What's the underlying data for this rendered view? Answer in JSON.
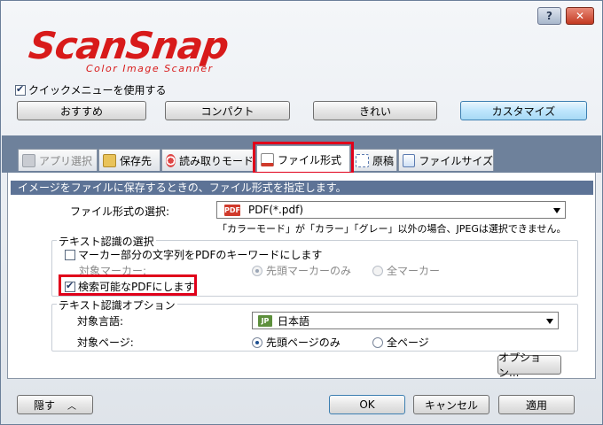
{
  "title_bar": {
    "help_label": "?",
    "close_label": "✕"
  },
  "logo": {
    "brand": "ScanSnap",
    "tagline": "Color Image Scanner"
  },
  "quick_menu": {
    "label": "クイックメニューを使用する",
    "checked": true
  },
  "modes": [
    {
      "label": "おすすめ"
    },
    {
      "label": "コンパクト"
    },
    {
      "label": "きれい"
    },
    {
      "label": "カスタマイズ",
      "selected": true
    }
  ],
  "tabs": [
    {
      "label": "アプリ選択",
      "icon": "app-select-icon",
      "disabled": true
    },
    {
      "label": "保存先",
      "icon": "folder-icon"
    },
    {
      "label": "読み取りモード",
      "icon": "scan-mode-icon"
    },
    {
      "label": "ファイル形式",
      "icon": "file-format-icon",
      "active": true
    },
    {
      "label": "原稿",
      "icon": "paper-icon"
    },
    {
      "label": "ファイルサイズ",
      "icon": "file-size-icon"
    }
  ],
  "panel": {
    "description": "イメージをファイルに保存するときの、ファイル形式を指定します。",
    "format_label": "ファイル形式の選択:",
    "format_value": "PDF(*.pdf)",
    "format_icon_text": "PDF",
    "format_note": "「カラーモード」が「カラー」「グレー」以外の場合、JPEGは選択できません。",
    "text_recognition": {
      "title": "テキスト認識の選択",
      "marker_keyword_label": "マーカー部分の文字列をPDFのキーワードにします",
      "target_marker_label": "対象マーカー:",
      "marker_first_only": "先頭マーカーのみ",
      "marker_all": "全マーカー",
      "searchable_pdf_label": "検索可能なPDFにします"
    },
    "text_options": {
      "title": "テキスト認識オプション",
      "language_label": "対象言語:",
      "language_icon_text": "JP",
      "language_value": "日本語",
      "page_label": "対象ページ:",
      "page_first_only": "先頭ページのみ",
      "page_all": "全ページ"
    },
    "options_button": "オプション..."
  },
  "footer": {
    "hide_label": "隠す",
    "ok_label": "OK",
    "cancel_label": "キャンセル",
    "apply_label": "適用"
  },
  "colors": {
    "brand_red": "#d81a1a",
    "highlight_red": "#e0001a",
    "band": "#6e819b"
  }
}
